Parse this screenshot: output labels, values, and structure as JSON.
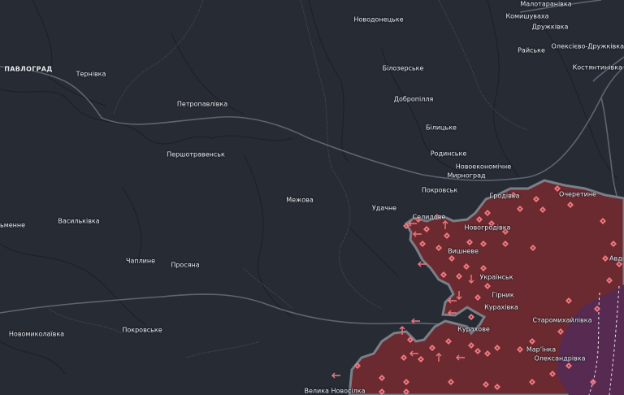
{
  "map": {
    "colors": {
      "background": "#272b33",
      "roads": "#5d6472",
      "rivers": "#1d2026",
      "borders": "#50565f",
      "occupied_fill": "#6e2b30",
      "occupied_edge": "#7a8088",
      "contested_fill": "#5a2c55",
      "marker": "#f0787e",
      "label": "#e6e8ec"
    },
    "marker_icons": [
      "diamond-cluster-icon",
      "arrow-left-icon",
      "arrow-up-icon",
      "arrow-down-icon"
    ],
    "labels": {
      "pavlohrad": "ПАВЛОГРАД",
      "ternivka": "Тернівка",
      "petropavlivka": "Петропавлівка",
      "pershotravensk": "Першотравенськ",
      "mezhova": "Межова",
      "novodonetske": "Новодонецьке",
      "bilozerske": "Білозерське",
      "dobropillia": "Добропілля",
      "bilytske": "Білицьке",
      "rodynske": "Родинське",
      "novoekonomichne": "Новоекономічне",
      "myrnohrad": "Мирноград",
      "pokrovsk_city": "Покровськ",
      "udachne": "Удачне",
      "malotaranivka": "Малотаранівка",
      "komyshuvakha": "Комишуваха",
      "druzhkivka": "Дружківка",
      "raiske": "Райське",
      "oleksiievo_druzhkivka": "Олексієво-Дружківка",
      "kostiantynivka": "Костянтинівка",
      "symenne": "ьменне",
      "vasylkivka": "Васильківка",
      "chaplyne": "Чаплине",
      "prosiana": "Просяна",
      "novomykolaivka": "Новомиколаївка",
      "pokrovske": "Покровське",
      "grodivka": "Гродівка",
      "ocheretyne": "Очеретине",
      "novohrodivka": "Новогродівка",
      "vyshneve": "Вишневе",
      "ukrainsk": "Українськ",
      "avdiivka": "Авді",
      "selydove": "Селидове",
      "hirnyk": "Гірник",
      "kurakhivka": "Курахівка",
      "staromykhailivka": "Старомихайлівка",
      "kurakhove": "Курахове",
      "marinka": "Мар'їнка",
      "oleksandrivka": "Олександрівка",
      "velyka_novosilka": "Велика Новосілка"
    }
  }
}
